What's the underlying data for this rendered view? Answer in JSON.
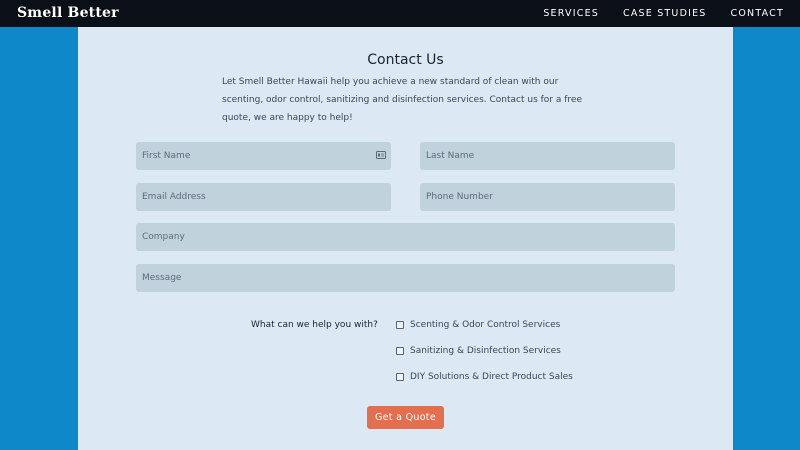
{
  "nav": {
    "brand": "Smell Better",
    "links": [
      "SERVICES",
      "CASE STUDIES",
      "CONTACT"
    ]
  },
  "form": {
    "title": "Contact Us",
    "intro": "Let Smell Better Hawaii help you achieve a new standard of clean with our scenting, odor control, sanitizing and disinfection services. Contact us for a free quote, we are happy to help!",
    "fields": {
      "first_name": "First Name",
      "last_name": "Last Name",
      "email": "Email Address",
      "phone": "Phone Number",
      "company": "Company",
      "message": "Message"
    },
    "question": "What can we help you with?",
    "options": [
      "Scenting & Odor Control Services",
      "Sanitizing & Disinfection Services",
      "DIY Solutions & Direct Product Sales"
    ],
    "submit_label": "Get a Quote"
  },
  "colors": {
    "navbar": "#0b0f17",
    "background": "#0e88c9",
    "panel": "#dce9f4",
    "field": "#c0d2dc",
    "button": "#e36f4e"
  },
  "icons": {
    "first_name_field": "contact-card-icon"
  }
}
